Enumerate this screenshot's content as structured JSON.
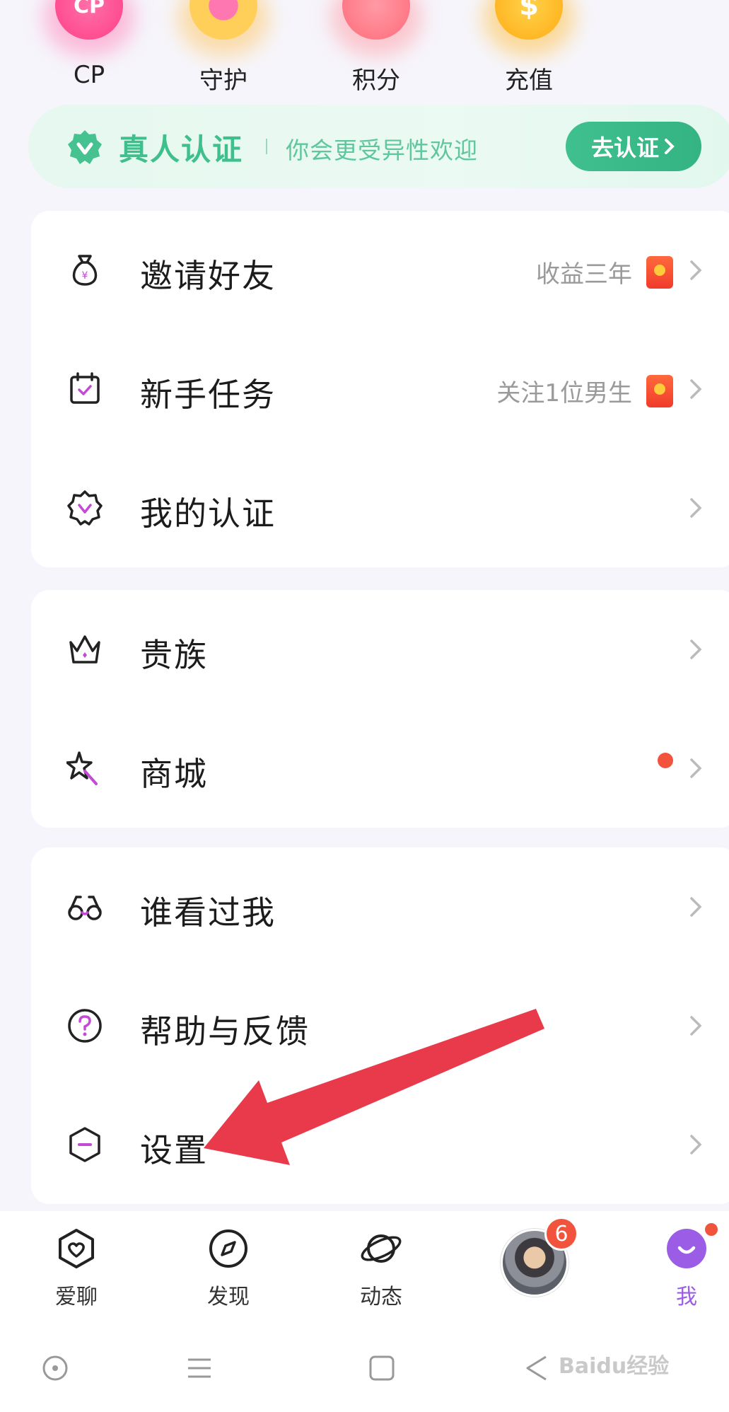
{
  "top_items": [
    {
      "label": "CP",
      "icon": "cp-heart-icon",
      "badge_text": "CP",
      "color": "#ff6fa8"
    },
    {
      "label": "守护",
      "icon": "guard-wings-heart-icon",
      "badge_text": "",
      "color": "#ffb43a"
    },
    {
      "label": "积分",
      "icon": "piggy-bank-icon",
      "badge_text": "",
      "color": "#ff7d8c"
    },
    {
      "label": "充值",
      "icon": "coin-dollar-icon",
      "badge_text": "$",
      "color": "#ffb21e"
    }
  ],
  "verify_banner": {
    "title": "真人认证",
    "subtitle": "你会更受异性欢迎",
    "button": "去认证",
    "accent": "#3fbf8c"
  },
  "menu_groups": [
    [
      {
        "label": "邀请好友",
        "icon": "money-bag-icon",
        "hint": "收益三年",
        "red_packet": true,
        "dot": false
      },
      {
        "label": "新手任务",
        "icon": "calendar-check-icon",
        "hint": "关注1位男生",
        "red_packet": true,
        "dot": false
      },
      {
        "label": "我的认证",
        "icon": "verified-badge-icon",
        "hint": "",
        "red_packet": false,
        "dot": false
      }
    ],
    [
      {
        "label": "贵族",
        "icon": "crown-icon",
        "hint": "",
        "red_packet": false,
        "dot": false
      },
      {
        "label": "商城",
        "icon": "magic-wand-star-icon",
        "hint": "",
        "red_packet": false,
        "dot": true
      }
    ],
    [
      {
        "label": "谁看过我",
        "icon": "glasses-icon",
        "hint": "",
        "red_packet": false,
        "dot": false
      },
      {
        "label": "帮助与反馈",
        "icon": "help-question-icon",
        "hint": "",
        "red_packet": false,
        "dot": false
      },
      {
        "label": "设置",
        "icon": "settings-hexagon-icon",
        "hint": "",
        "red_packet": false,
        "dot": false
      }
    ]
  ],
  "bottom_nav": [
    {
      "label": "爱聊",
      "icon": "chat-heart-icon"
    },
    {
      "label": "发现",
      "icon": "compass-icon"
    },
    {
      "label": "动态",
      "icon": "planet-icon"
    },
    {
      "label": "",
      "icon": "avatar",
      "badge": "6"
    },
    {
      "label": "我",
      "icon": "me-smile-icon",
      "active": true
    }
  ],
  "system_nav": [
    "recents-circle-icon",
    "menu-lines-icon",
    "home-square-icon",
    "back-triangle-icon"
  ],
  "watermark": "Baidu经验",
  "colors": {
    "accent_green": "#3fbf8c",
    "purple": "#9b5de5",
    "red": "#f2533d",
    "arrow": "#e83a4a"
  }
}
